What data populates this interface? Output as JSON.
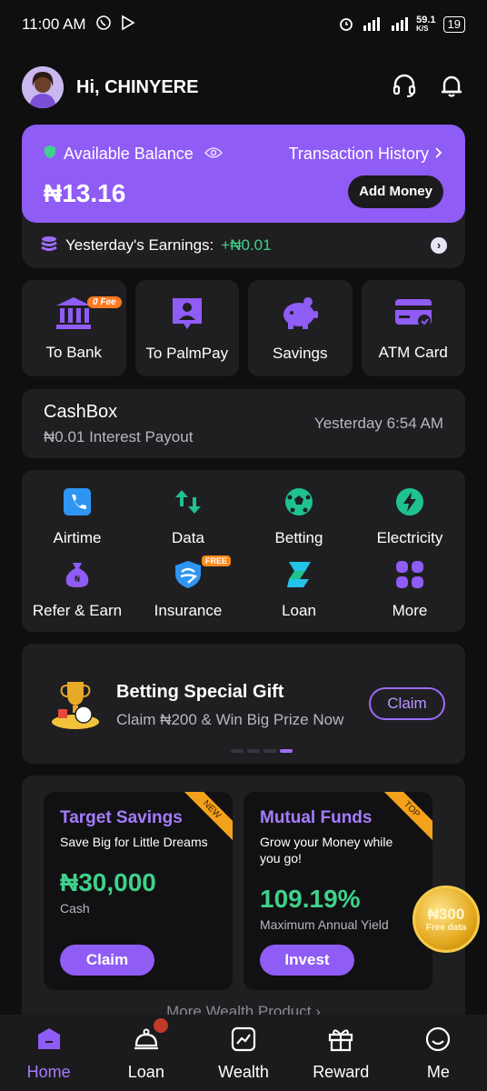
{
  "status_bar": {
    "time": "11:00 AM",
    "net_speed": "59.1",
    "net_unit": "K/S",
    "battery": "19"
  },
  "header": {
    "greeting": "Hi, CHINYERE"
  },
  "balance": {
    "label": "Available Balance",
    "history_link": "Transaction History",
    "amount": "₦13.16",
    "add_money": "Add Money",
    "earnings_label": "Yesterday's Earnings:",
    "earnings_value": "+₦0.01"
  },
  "transfer": [
    {
      "label": "To Bank",
      "badge": "0 Fee"
    },
    {
      "label": "To PalmPay"
    },
    {
      "label": "Savings"
    },
    {
      "label": "ATM Card"
    }
  ],
  "cashbox": {
    "title": "CashBox",
    "sub": "₦0.01 Interest Payout",
    "time": "Yesterday 6:54 AM"
  },
  "services": [
    {
      "label": "Airtime"
    },
    {
      "label": "Data"
    },
    {
      "label": "Betting"
    },
    {
      "label": "Electricity"
    },
    {
      "label": "Refer & Earn"
    },
    {
      "label": "Insurance",
      "badge": "FREE"
    },
    {
      "label": "Loan"
    },
    {
      "label": "More"
    }
  ],
  "promo": {
    "title": "Betting Special Gift",
    "sub": "Claim ₦200 & Win Big Prize Now",
    "button": "Claim"
  },
  "wealth": {
    "cards": [
      {
        "title": "Target Savings",
        "desc": "Save Big for Little Dreams",
        "value": "₦30,000",
        "caption": "Cash",
        "button": "Claim",
        "ribbon": "NEW"
      },
      {
        "title": "Mutual Funds",
        "desc": "Grow your Money while you go!",
        "value": "109.19%",
        "caption": "Maximum Annual Yield",
        "button": "Invest",
        "ribbon": "TOP"
      }
    ],
    "more": "More Wealth Product"
  },
  "coin": {
    "amount": "₦300",
    "text": "Free data"
  },
  "tabs": [
    {
      "label": "Home"
    },
    {
      "label": "Loan"
    },
    {
      "label": "Wealth"
    },
    {
      "label": "Reward"
    },
    {
      "label": "Me"
    }
  ],
  "colors": {
    "accent": "#8f5cf6",
    "positive": "#3fd18a",
    "card": "#1f1f22",
    "background": "#0f0f10"
  }
}
